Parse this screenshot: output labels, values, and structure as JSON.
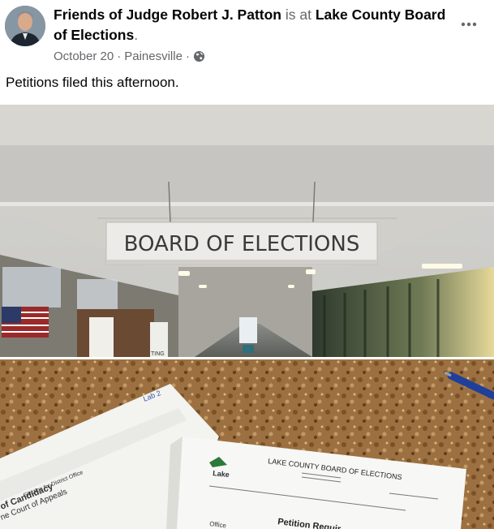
{
  "post": {
    "author": "Friends of Judge Robert J. Patton",
    "connector": "is at",
    "location": "Lake County Board of Elections",
    "trailing": ".",
    "date": "October 20",
    "place": "Painesville",
    "sep": "·",
    "audience_icon": "globe-icon",
    "text": "Petitions filed this afternoon."
  },
  "photo1": {
    "sign_text": "BOARD OF ELECTIONS",
    "partial_sign": "TING"
  },
  "photo2": {
    "letterhead": "LAKE COUNTY BOARD OF ELECTIONS",
    "logo_text": "Lake",
    "section_title": "Petition Requir",
    "office_label": "Office",
    "left_doc_lines": [
      "of Candidacy",
      "ne Court of Appeals",
      "Election for District Office"
    ],
    "handwriting": "Lab 2"
  },
  "colors": {
    "muted": "#65676b",
    "text": "#050505"
  }
}
